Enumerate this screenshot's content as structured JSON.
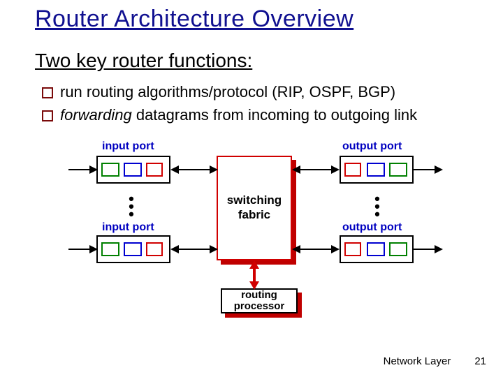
{
  "title": "Router Architecture Overview",
  "subtitle": "Two key router functions:",
  "bullets": [
    {
      "plain": "run routing algorithms/protocol (RIP, OSPF, BGP)"
    },
    {
      "italic": "forwarding",
      "plain": " datagrams from incoming to outgoing link"
    }
  ],
  "diagram": {
    "input_label": "input port",
    "output_label": "output port",
    "switching_label": "switching\nfabric",
    "routing_label": "routing\nprocessor"
  },
  "footer": {
    "section": "Network Layer",
    "page": "21"
  }
}
